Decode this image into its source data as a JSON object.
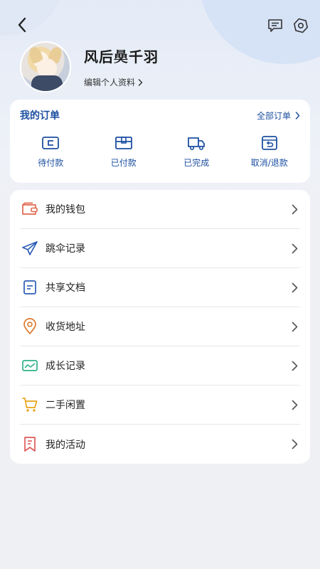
{
  "header": {
    "back_icon": "chevron-left-icon",
    "message_icon": "chat-bubble-icon",
    "settings_icon": "settings-hexagon-icon"
  },
  "profile": {
    "username": "风后𣊖千羽",
    "edit_label": "编辑个人资料"
  },
  "orders": {
    "title": "我的订单",
    "all_label": "全部订单",
    "items": [
      {
        "label": "待付款",
        "icon": "wallet-card-icon"
      },
      {
        "label": "已付款",
        "icon": "package-box-icon"
      },
      {
        "label": "已完成",
        "icon": "delivery-truck-icon"
      },
      {
        "label": "取消/退款",
        "icon": "refund-return-icon"
      }
    ]
  },
  "menu": {
    "items": [
      {
        "label": "我的钱包",
        "icon": "wallet-icon",
        "color": "#e0674f"
      },
      {
        "label": "跳伞记录",
        "icon": "paper-plane-icon",
        "color": "#2c5cb5"
      },
      {
        "label": "共享文档",
        "icon": "document-icon",
        "color": "#2c5cb5"
      },
      {
        "label": "收货地址",
        "icon": "location-pin-icon",
        "color": "#e0792e"
      },
      {
        "label": "成长记录",
        "icon": "growth-chart-icon",
        "color": "#2fb18a"
      },
      {
        "label": "二手闲置",
        "icon": "shopping-cart-icon",
        "color": "#e8a317"
      },
      {
        "label": "我的活动",
        "icon": "bookmark-flag-icon",
        "color": "#e05a5a"
      }
    ]
  },
  "colors": {
    "accent": "#1d4fa0",
    "card_bg": "#ffffff",
    "page_bg": "#eef0f4"
  }
}
